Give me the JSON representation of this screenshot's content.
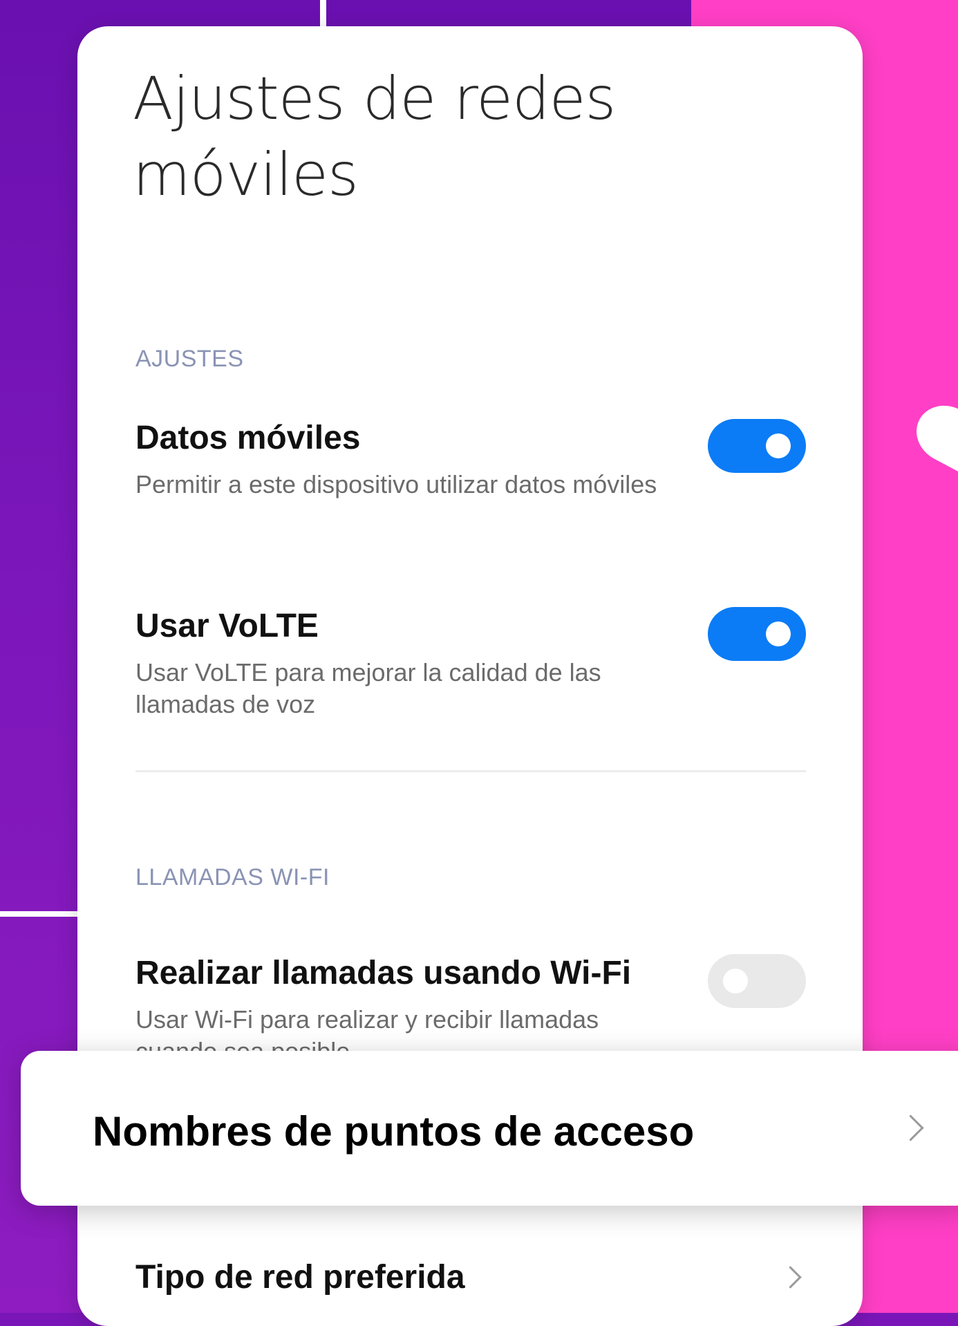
{
  "page": {
    "title": "Ajustes de redes móviles"
  },
  "sections": {
    "settings_label": "AJUSTES",
    "wifi_calls_label": "LLAMADAS WI-FI"
  },
  "rows": {
    "mobile_data": {
      "title": "Datos móviles",
      "subtitle": "Permitir a este dispositivo utilizar datos móviles",
      "enabled": true
    },
    "volte": {
      "title": "Usar VoLTE",
      "subtitle": "Usar VoLTE para mejorar la calidad de las llamadas de voz",
      "enabled": true
    },
    "wifi_calling": {
      "title": "Realizar llamadas usando Wi-Fi",
      "subtitle": "Usar Wi-Fi para realizar y recibir llamadas cuando sea posible",
      "enabled": false
    },
    "preferred_network": {
      "title": "Tipo de red preferida"
    }
  },
  "highlight": {
    "label": "Nombres de puntos de acceso"
  },
  "colors": {
    "toggle_on": "#0b7cf6",
    "toggle_off": "#e9e9e9",
    "background_purple": "#7a16b8",
    "background_pink": "#ff3fc6"
  },
  "icons": {
    "chevron": "chevron-right-icon"
  }
}
